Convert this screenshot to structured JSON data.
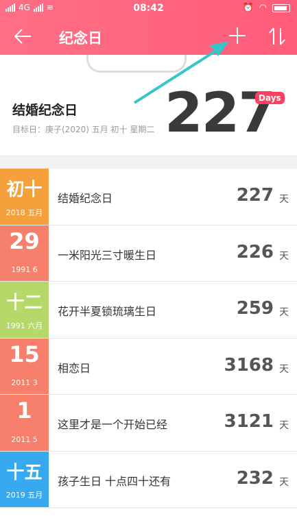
{
  "status": {
    "network": "4G",
    "time": "08:42"
  },
  "header": {
    "title": "纪念日",
    "back_icon": "back-arrow-icon",
    "add_icon": "plus-icon",
    "sort_icon": "sort-icon"
  },
  "hero": {
    "name": "结婚纪念日",
    "target": "目标日：庚子(2020) 五月 初十 星期二",
    "count": "227",
    "badge": "Days"
  },
  "colors": {
    "header": "#ff6680",
    "orange": "#f5a03a",
    "salmon": "#f6806b",
    "lime": "#b6d86a",
    "blue": "#37a9f0",
    "days_badge": "#ff3f5f"
  },
  "list": [
    {
      "big": "初十",
      "small": "2018 五月",
      "name": "结婚纪念日",
      "count": "227",
      "unit": "天",
      "color": "#f5a03a"
    },
    {
      "big": "29",
      "small": "1991 6",
      "name": "一米阳光三寸暖生日",
      "count": "226",
      "unit": "天",
      "color": "#f6806b"
    },
    {
      "big": "十二",
      "small": "1991 六月",
      "name": "花开半夏锁琉璃生日",
      "count": "259",
      "unit": "天",
      "color": "#b6d86a"
    },
    {
      "big": "15",
      "small": "2011 3",
      "name": "相恋日",
      "count": "3168",
      "unit": "天",
      "color": "#f6806b"
    },
    {
      "big": "1",
      "small": "2011 5",
      "name": "这里才是一个开始已经",
      "count": "3121",
      "unit": "天",
      "color": "#f6806b"
    },
    {
      "big": "十五",
      "small": "2019 五月",
      "name": "孩子生日 十点四十还有",
      "count": "232",
      "unit": "天",
      "color": "#37a9f0"
    }
  ]
}
